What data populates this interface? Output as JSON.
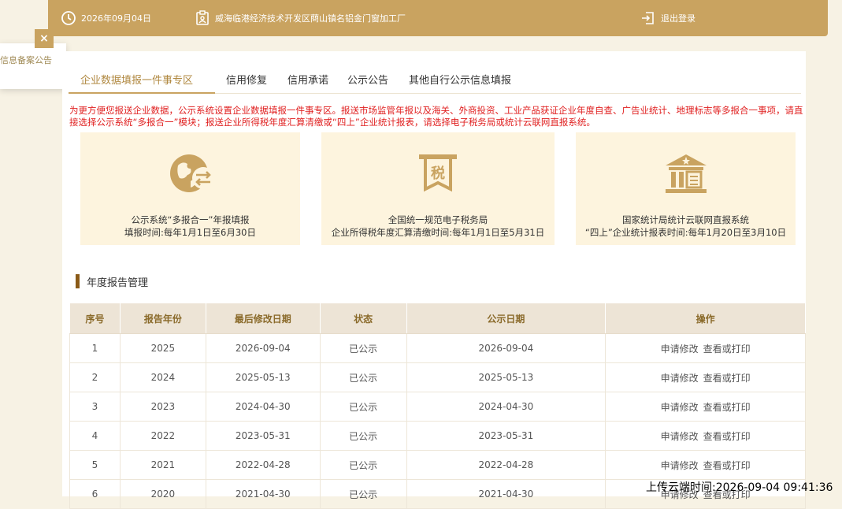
{
  "topbar": {
    "date": "2026年09月04日",
    "company": "威海临港经济技术开发区蔄山镇名铝金门窗加工厂",
    "logout": "退出登录"
  },
  "side_notice": {
    "text": "信息备案公告",
    "close": "×"
  },
  "tabs": [
    "企业数据填报一件事专区",
    "信用修复",
    "信用承诺",
    "公示公告",
    "其他自行公示信息填报"
  ],
  "notice": "为更方便您报送企业数据，公示系统设置企业数据填报一件事专区。报送市场监管年报以及海关、外商投资、工业产品获证企业年度自查、广告业统计、地理标志等多报合一事项，请直接选择公示系统“多报合一”模块；报送企业所得税年度汇算清缴或“四上”企业统计报表，请选择电子税务局或统计云联网直报系统。",
  "cards": [
    {
      "line1": "公示系统“多报合一”年报填报",
      "line2": "填报时间:每年1月1日至6月30日",
      "icon": "globe-exchange-icon"
    },
    {
      "line1": "全国统一规范电子税务局",
      "line2": "企业所得税年度汇算清缴时间:每年1月1日至5月31日",
      "icon": "tax-icon",
      "icon_text": "税"
    },
    {
      "line1": "国家统计局统计云联网直报系统",
      "line2": "“四上”企业统计报表时间:每年1月20日至3月10日",
      "icon": "government-building-icon"
    }
  ],
  "section_title": "年度报告管理",
  "table": {
    "headers": [
      "序号",
      "报告年份",
      "最后修改日期",
      "状态",
      "公示日期",
      "操作"
    ],
    "rows": [
      [
        "1",
        "2025",
        "2026-09-04",
        "已公示",
        "2026-09-04"
      ],
      [
        "2",
        "2024",
        "2025-05-13",
        "已公示",
        "2025-05-13"
      ],
      [
        "3",
        "2023",
        "2024-04-30",
        "已公示",
        "2024-04-30"
      ],
      [
        "4",
        "2022",
        "2023-05-31",
        "已公示",
        "2023-05-31"
      ],
      [
        "5",
        "2021",
        "2022-04-28",
        "已公示",
        "2022-04-28"
      ],
      [
        "6",
        "2020",
        "2021-04-30",
        "已公示",
        "2021-04-30"
      ]
    ],
    "action_modify": "申请修改",
    "action_view": "查看或打印"
  },
  "upload_stamp": "上传云端时间:2026-09-04 09:41:36",
  "colors": {
    "accent": "#c9a360",
    "notice": "#e02020",
    "card_bg": "#fdf4de"
  }
}
